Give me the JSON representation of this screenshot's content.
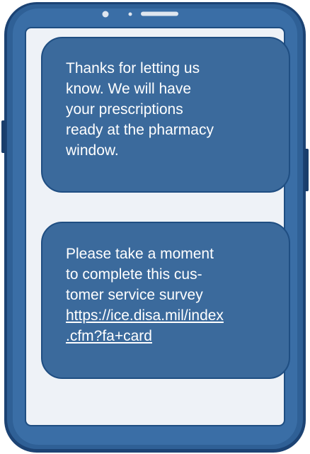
{
  "colors": {
    "phone_frame": "#2b5a8f",
    "phone_frame_dark": "#1c4374",
    "screen_background": "#eef2f7",
    "bubble_fill": "#3b6a9c",
    "bubble_border": "#1f4e82",
    "text": "#ffffff"
  },
  "icons": {
    "camera": "front-camera-icon",
    "sensor": "sensor-icon",
    "speaker": "speaker-grille-icon"
  },
  "messages": [
    {
      "lines": [
        "Thanks for letting us",
        "know. We will have",
        "your prescriptions",
        "ready at the pharmacy",
        "window."
      ]
    },
    {
      "lines": [
        "Please take a moment",
        "to complete this cus-",
        "tomer service survey"
      ],
      "link_lines": [
        "https://ice.disa.mil/index",
        ".cfm?fa+card"
      ]
    }
  ]
}
